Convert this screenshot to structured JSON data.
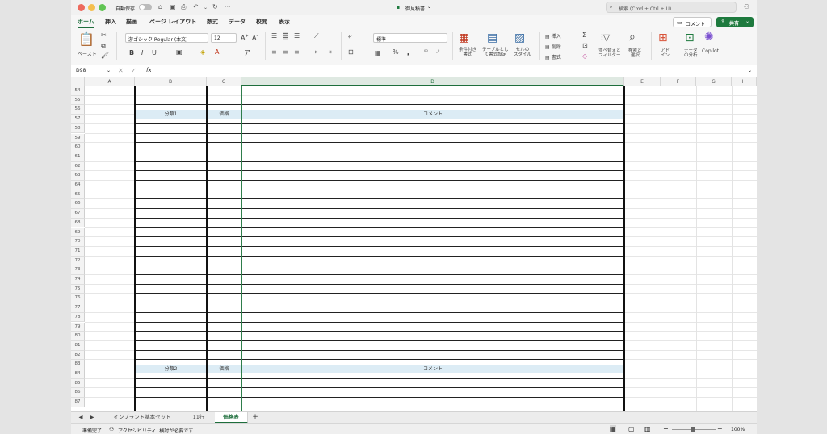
{
  "titlebar": {
    "autosave": "自動保存",
    "filename": "御見積書",
    "search_placeholder": "検索 (Cmd + Ctrl + U)"
  },
  "menu": {
    "items": [
      "ホーム",
      "挿入",
      "描画",
      "ページ レイアウト",
      "数式",
      "データ",
      "校閲",
      "表示"
    ],
    "comment": "コメント",
    "share": "共有"
  },
  "ribbon": {
    "paste": "ペースト",
    "font_name": "游ゴシック Regular (本文)",
    "font_size": "12",
    "number_format": "標準",
    "cond_format": [
      "条件付き",
      "書式"
    ],
    "table_format": [
      "テーブルとし",
      "て書式設定"
    ],
    "cell_style": [
      "セルの",
      "スタイル"
    ],
    "insert": "挿入",
    "delete": "削除",
    "format": "書式",
    "sort_filter": [
      "並べ替えと",
      "フィルター"
    ],
    "find_select": [
      "検索と",
      "選択"
    ],
    "addin": [
      "アド",
      "イン"
    ],
    "data_analysis": [
      "データ",
      "の分析"
    ],
    "copilot": "Copilot"
  },
  "formula_bar": {
    "cell_ref": "D98",
    "fx": "fx",
    "value": ""
  },
  "grid": {
    "columns": [
      "A",
      "B",
      "C",
      "D",
      "E",
      "F",
      "G",
      "H"
    ],
    "selected_column": "D",
    "rows": [
      "54",
      "55",
      "56",
      "57",
      "58",
      "59",
      "60",
      "61",
      "62",
      "63",
      "64",
      "65",
      "66",
      "67",
      "68",
      "69",
      "70",
      "71",
      "72",
      "73",
      "74",
      "75",
      "76",
      "77",
      "78",
      "79",
      "80",
      "81",
      "82",
      "83",
      "84",
      "85",
      "86",
      "87"
    ],
    "header_rows": [
      {
        "row": "56",
        "b": "分類1",
        "c": "価格",
        "d": "コメント"
      },
      {
        "row": "83",
        "b": "分類2",
        "c": "価格",
        "d": "コメント"
      }
    ],
    "colors": {
      "header_band": "#dcecf5",
      "accent": "#1e6e3c"
    }
  },
  "sheets": {
    "tabs": [
      "インプラント基本セット",
      "11行",
      "価格表"
    ],
    "active": "価格表",
    "add": "+"
  },
  "status": {
    "ready": "準備完了",
    "accessibility": "アクセシビリティ: 検討が必要です",
    "zoom": "100%"
  }
}
